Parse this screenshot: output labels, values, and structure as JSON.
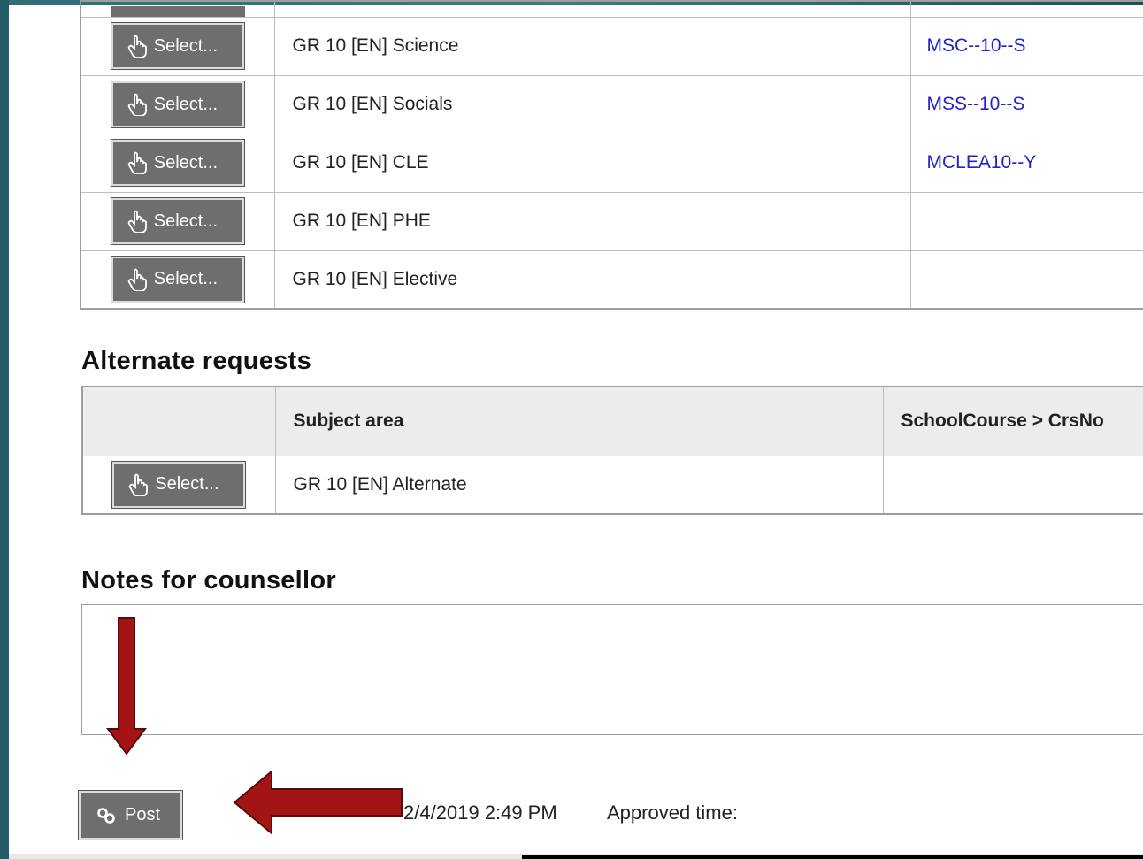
{
  "course_requests": {
    "rows": [
      {
        "button": "Select...",
        "subject": "GR 10 [EN] Science",
        "code": "MSC--10--S"
      },
      {
        "button": "Select...",
        "subject": "GR 10 [EN] Socials",
        "code": "MSS--10--S"
      },
      {
        "button": "Select...",
        "subject": "GR 10 [EN] CLE",
        "code": "MCLEA10--Y"
      },
      {
        "button": "Select...",
        "subject": "GR 10 [EN] PHE",
        "code": ""
      },
      {
        "button": "Select...",
        "subject": "GR 10 [EN] Elective",
        "code": ""
      }
    ]
  },
  "alternate": {
    "heading": "Alternate requests",
    "columns": [
      "",
      "Subject area",
      "SchoolCourse > CrsNo"
    ],
    "rows": [
      {
        "button": "Select...",
        "subject": "GR 10 [EN] Alternate",
        "code": ""
      }
    ]
  },
  "notes": {
    "heading": "Notes for counsellor",
    "value": ""
  },
  "footer": {
    "post_label": "Post",
    "request_time": "2/4/2019 2:49 PM",
    "approved_label": "Approved time:"
  },
  "colors": {
    "button_bg": "#6e6e6e",
    "link_blue": "#2323c8",
    "arrow_red": "#a31515",
    "frame_teal": "#1d4f5a"
  },
  "icons": {
    "select": "hand-pointer-icon",
    "post": "post-link-icon"
  }
}
